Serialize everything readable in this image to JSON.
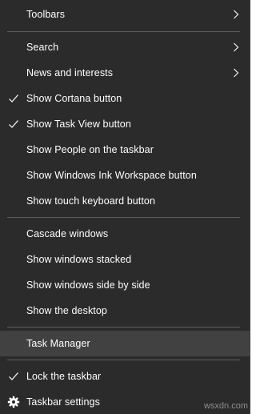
{
  "colors": {
    "menu_bg": "#2b2b2b",
    "highlight_bg": "#414141",
    "separator": "#5d5d5d",
    "text": "#ffffff"
  },
  "menu": {
    "items": [
      {
        "label": "Toolbars",
        "submenu": true,
        "checked": false
      },
      {
        "label": "Search",
        "submenu": true,
        "checked": false
      },
      {
        "label": "News and interests",
        "submenu": true,
        "checked": false
      },
      {
        "label": "Show Cortana button",
        "submenu": false,
        "checked": true
      },
      {
        "label": "Show Task View button",
        "submenu": false,
        "checked": true
      },
      {
        "label": "Show People on the taskbar",
        "submenu": false,
        "checked": false
      },
      {
        "label": "Show Windows Ink Workspace button",
        "submenu": false,
        "checked": false
      },
      {
        "label": "Show touch keyboard button",
        "submenu": false,
        "checked": false
      },
      {
        "label": "Cascade windows",
        "submenu": false,
        "checked": false
      },
      {
        "label": "Show windows stacked",
        "submenu": false,
        "checked": false
      },
      {
        "label": "Show windows side by side",
        "submenu": false,
        "checked": false
      },
      {
        "label": "Show the desktop",
        "submenu": false,
        "checked": false
      },
      {
        "label": "Task Manager",
        "submenu": false,
        "checked": false,
        "highlighted": true
      },
      {
        "label": "Lock the taskbar",
        "submenu": false,
        "checked": true
      },
      {
        "label": "Taskbar settings",
        "submenu": false,
        "checked": false,
        "icon": "gear-icon"
      }
    ]
  },
  "watermark": "wsxdn.com"
}
